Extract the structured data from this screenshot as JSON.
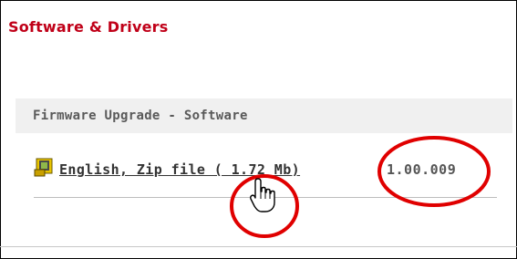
{
  "page": {
    "title": "Software & Drivers"
  },
  "section": {
    "header": "Firmware Upgrade - Software"
  },
  "download": {
    "link_label": "English, Zip file ( 1.72 Mb)",
    "version": "1.00.009",
    "icon": "zip-file-icon"
  },
  "cursor": {
    "icon": "hand-pointer-icon"
  },
  "colors": {
    "title": "#c00018",
    "annotation": "#e00000",
    "section_bg": "#f0f0f0"
  }
}
